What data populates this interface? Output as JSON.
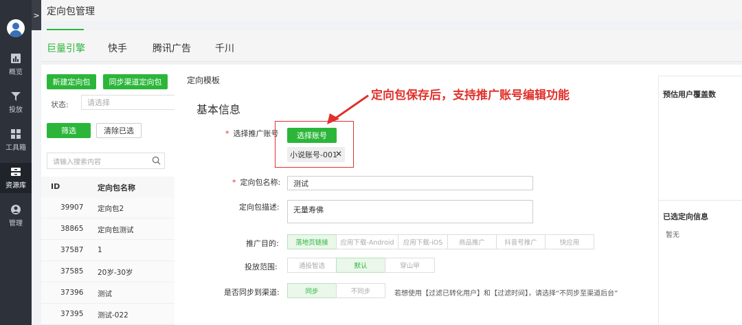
{
  "sidebar": {
    "expand_glyph": ">",
    "items": [
      {
        "label": "概览",
        "icon": "bar-chart-icon"
      },
      {
        "label": "投放",
        "icon": "send-icon"
      },
      {
        "label": "工具箱",
        "icon": "grid-icon"
      },
      {
        "label": "资源库",
        "icon": "database-icon",
        "active": true
      },
      {
        "label": "管理",
        "icon": "user-icon"
      }
    ]
  },
  "header": {
    "title": "定向包管理"
  },
  "tabs": [
    {
      "label": "巨量引擎",
      "active": true
    },
    {
      "label": "快手"
    },
    {
      "label": "腾讯广告"
    },
    {
      "label": "千川"
    }
  ],
  "leftpanel": {
    "new_button": "新建定向包",
    "sync_button": "同步渠道定向包",
    "status_label": "状态:",
    "status_placeholder": "请选择",
    "filter_button": "筛选",
    "clear_button": "清除已选",
    "search_placeholder": "请输入搜索内容",
    "columns": [
      "ID",
      "定向包名称"
    ],
    "rows": [
      {
        "id": "39907",
        "name": "定向包2"
      },
      {
        "id": "38865",
        "name": "定向包测试"
      },
      {
        "id": "37587",
        "name": "1"
      },
      {
        "id": "37585",
        "name": "20岁-30岁"
      },
      {
        "id": "37396",
        "name": "测试"
      },
      {
        "id": "37395",
        "name": "测试-022"
      }
    ]
  },
  "modal": {
    "title": "定向模板",
    "section_title": "基本信息",
    "account_label": "选择推广账号",
    "select_account_button": "选择账号",
    "selected_account": "小说账号-001",
    "name_label": "定向包名称:",
    "name_value": "测试",
    "desc_label": "定向包描述:",
    "desc_value": "无量寿佛",
    "goal_label": "推广目的:",
    "goal_options": [
      "落地页链接",
      "应用下载-Android",
      "应用下载-iOS",
      "商品推广",
      "抖音号推广",
      "快应用"
    ],
    "scope_label": "投放范围:",
    "scope_options": [
      "通投智选",
      "默认",
      "穿山甲"
    ],
    "sync_label": "是否同步到渠道:",
    "sync_options": [
      "同步",
      "不同步"
    ],
    "sync_hint": "若想使用【过滤已转化用户】和【过滤时间】，请选择“不同步至渠道后台”"
  },
  "annotation": "定向包保存后，支持推广账号编辑功能",
  "rightpanel": {
    "coverage_title": "预估用户覆盖数",
    "selected_title": "已选定向信息",
    "selected_empty": "暂无"
  },
  "colors": {
    "accent": "#2bb63a",
    "annotation": "#e0302b",
    "sidebar": "#2d323a"
  }
}
